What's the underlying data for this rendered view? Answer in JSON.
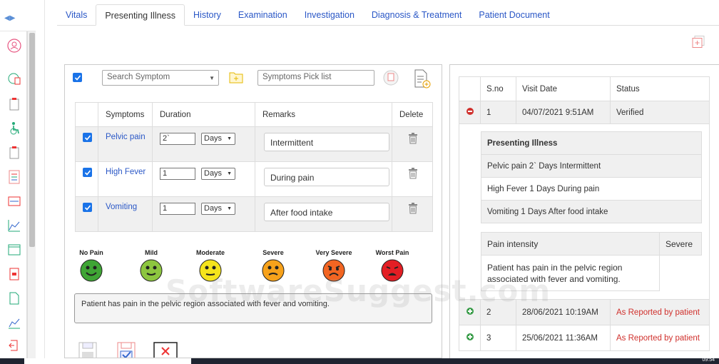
{
  "tabs": [
    {
      "label": "Vitals"
    },
    {
      "label": "Presenting Illness"
    },
    {
      "label": "History"
    },
    {
      "label": "Examination"
    },
    {
      "label": "Investigation"
    },
    {
      "label": "Diagnosis & Treatment"
    },
    {
      "label": "Patient Document"
    }
  ],
  "active_tab": "Presenting Illness",
  "symptom_panel": {
    "search_placeholder": "Search Symptom",
    "picklist_placeholder": "Symptoms Pick list",
    "columns": [
      "Symptoms",
      "Duration",
      "Remarks",
      "Delete"
    ],
    "rows": [
      {
        "checked": true,
        "symptom": "Pelvic pain",
        "duration": "2`",
        "unit": "Days",
        "remarks": "Intermittent"
      },
      {
        "checked": true,
        "symptom": "High Fever",
        "duration": "1",
        "unit": "Days",
        "remarks": "During pain"
      },
      {
        "checked": true,
        "symptom": "Vomiting",
        "duration": "1",
        "unit": "Days",
        "remarks": "After food intake"
      }
    ],
    "pain_scale": [
      {
        "label": "No Pain",
        "color": "#3fa535"
      },
      {
        "label": "Mild",
        "color": "#8dc63f"
      },
      {
        "label": "Moderate",
        "color": "#f5e41c"
      },
      {
        "label": "Severe",
        "color": "#f7a21b"
      },
      {
        "label": "Very Severe",
        "color": "#f26522"
      },
      {
        "label": "Worst Pain",
        "color": "#e31e24"
      }
    ],
    "summary": "Patient has pain in the pelvic region associated with fever and vomiting."
  },
  "visits_panel": {
    "columns": [
      "S.no",
      "Visit Date",
      "Status"
    ],
    "visits": [
      {
        "sno": "1",
        "date": "04/07/2021 9:51AM",
        "status": "Verified",
        "expanded": true
      },
      {
        "sno": "2",
        "date": "28/06/2021 10:19AM",
        "status": "As Reported by patient",
        "expanded": false
      },
      {
        "sno": "3",
        "date": "25/06/2021 11:36AM",
        "status": "As Reported by patient",
        "expanded": false
      }
    ],
    "detail": {
      "heading": "Presenting Illness",
      "lines": [
        "Pelvic pain 2` Days Intermittent",
        "High Fever 1 Days During pain",
        "Vomiting 1 Days After food intake"
      ],
      "pain_label": "Pain intensity",
      "pain_value": "Severe",
      "note": "Patient has pain in the pelvic region associated with fever and vomiting."
    }
  },
  "watermark": "SoftwareSuggest.com",
  "clock": "09:54"
}
